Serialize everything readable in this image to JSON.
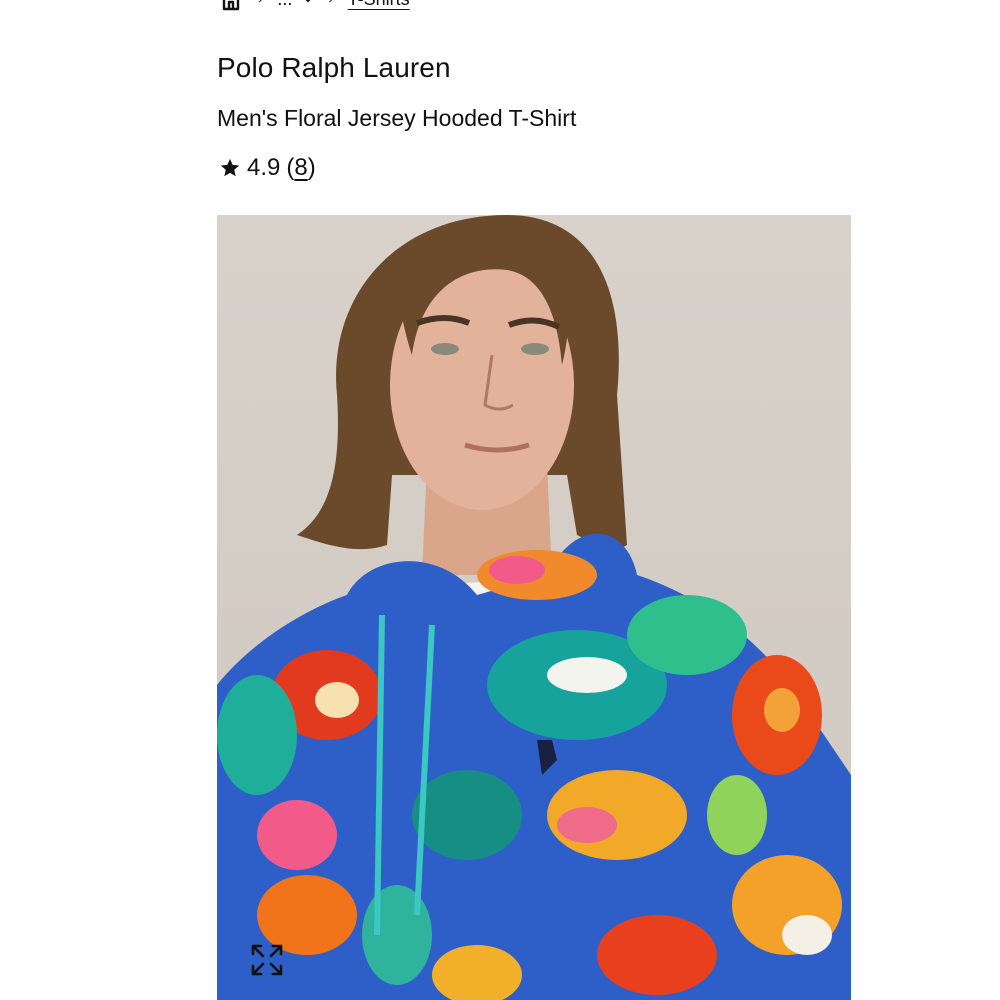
{
  "breadcrumb": {
    "home_icon": "home-icon",
    "more_label": "...",
    "more_icon": "chevron-down-icon",
    "current_link": "T-Shirts"
  },
  "product": {
    "brand": "Polo Ralph Lauren",
    "name": "Men's Floral Jersey Hooded T-Shirt",
    "rating_value": "4.9",
    "rating_open": "(",
    "rating_count": "8",
    "rating_close": ")",
    "star_icon": "star-icon"
  },
  "image": {
    "expand_icon": "expand-icon"
  }
}
